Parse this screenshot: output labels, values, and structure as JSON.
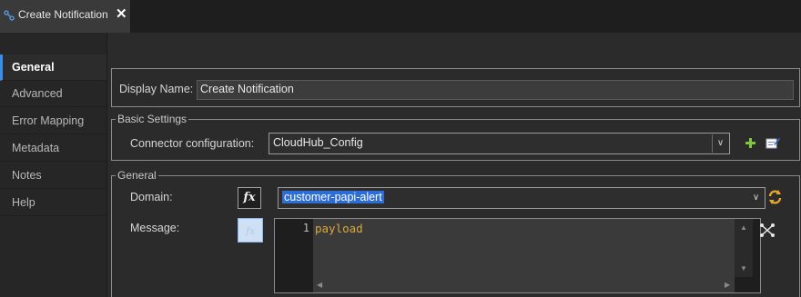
{
  "tab": {
    "title": "Create Notification",
    "close_label": "✕"
  },
  "sidebar": {
    "items": [
      {
        "label": "General",
        "active": true
      },
      {
        "label": "Advanced"
      },
      {
        "label": "Error Mapping"
      },
      {
        "label": "Metadata"
      },
      {
        "label": "Notes"
      },
      {
        "label": "Help"
      }
    ]
  },
  "display": {
    "label": "Display Name:",
    "value": "Create Notification"
  },
  "basic_settings": {
    "legend": "Basic Settings",
    "connector_label": "Connector configuration:",
    "connector_value": "CloudHub_Config"
  },
  "general": {
    "legend": "General",
    "domain_label": "Domain:",
    "domain_value": "customer-papi-alert",
    "message_label": "Message:",
    "fx_label": "fx"
  },
  "editor": {
    "line_number": "1",
    "code": "payload"
  },
  "colors": {
    "accent": "#3b8ee8",
    "selection": "#2d6ed6",
    "code": "#d9a93c",
    "add": "#7ec93b"
  }
}
